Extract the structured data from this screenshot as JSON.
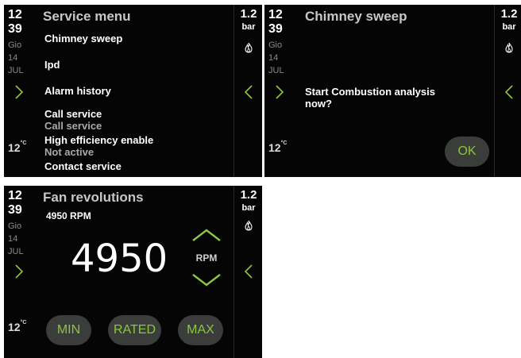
{
  "common": {
    "hour": "12",
    "minute": "39",
    "weekday": "Gio",
    "day": "14",
    "month": "JUL",
    "temp_value": "12",
    "temp_unit": "°C",
    "pressure_value": "1.2",
    "pressure_unit": "bar"
  },
  "screen1": {
    "title": "Service menu",
    "items": [
      {
        "label": "Chimney sweep"
      },
      {
        "label": "Ipd"
      },
      {
        "label": "Alarm history"
      },
      {
        "label": "Call service",
        "sub": "Call service"
      },
      {
        "label": "High efficiency enable",
        "sub": "Not active"
      },
      {
        "label": "Contact service"
      }
    ]
  },
  "screen2": {
    "title": "Chimney sweep",
    "message_line1": "Start Combustion analysis",
    "message_line2": "now?",
    "ok_label": "OK"
  },
  "screen3": {
    "title": "Fan revolutions",
    "subtitle": "4950 RPM",
    "value": "4950",
    "unit": "RPM",
    "buttons": {
      "min": "MIN",
      "rated": "RATED",
      "max": "MAX"
    }
  },
  "colors": {
    "accent": "#8dc63f",
    "panel_bg": "#050505",
    "pill_bg": "#3a3d3a"
  },
  "icons": [
    "chevron-right-icon",
    "chevron-left-icon",
    "flame-icon",
    "chevron-up-icon",
    "chevron-down-icon"
  ]
}
